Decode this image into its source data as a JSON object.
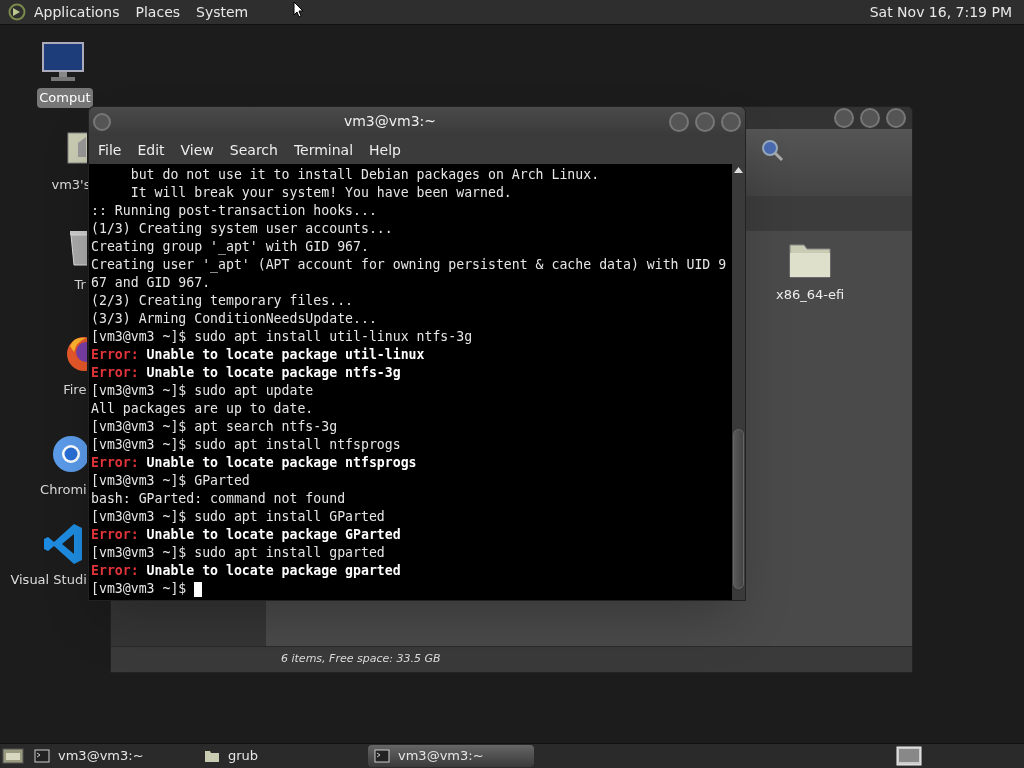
{
  "top_panel": {
    "menus": [
      "Applications",
      "Places",
      "System"
    ],
    "clock": "Sat Nov 16,  7:19 PM"
  },
  "desktop_icons": [
    {
      "kind": "computer",
      "label": "Comput",
      "selected": true
    },
    {
      "kind": "home",
      "label": "vm3's",
      "selected": false
    },
    {
      "kind": "trash",
      "label": "Tr",
      "selected": false
    },
    {
      "kind": "firefox",
      "label": "Fire",
      "selected": false
    },
    {
      "kind": "chromium",
      "label": "Chromi",
      "selected": false
    },
    {
      "kind": "vscode",
      "label": "Visual Studi",
      "selected": false
    }
  ],
  "file_manager": {
    "items": [
      {
        "kind": "folder",
        "label": "x86_64-efi"
      }
    ],
    "status_bar": "6 items, Free space: 33.5 GB"
  },
  "terminal": {
    "title": "vm3@vm3:~",
    "menu": [
      "File",
      "Edit",
      "View",
      "Search",
      "Terminal",
      "Help"
    ],
    "lines": [
      {
        "kind": "plain",
        "text": "     but do not use it to install Debian packages on Arch Linux."
      },
      {
        "kind": "plain",
        "text": "     It will break your system! You have been warned."
      },
      {
        "kind": "plain",
        "text": ":: Running post-transaction hooks..."
      },
      {
        "kind": "plain",
        "text": "(1/3) Creating system user accounts..."
      },
      {
        "kind": "plain",
        "text": "Creating group '_apt' with GID 967."
      },
      {
        "kind": "plain",
        "text": "Creating user '_apt' (APT account for owning persistent & cache data) with UID 9"
      },
      {
        "kind": "plain",
        "text": "67 and GID 967."
      },
      {
        "kind": "plain",
        "text": "(2/3) Creating temporary files..."
      },
      {
        "kind": "plain",
        "text": "(3/3) Arming ConditionNeedsUpdate..."
      },
      {
        "kind": "plain",
        "text": "[vm3@vm3 ~]$ sudo apt install util-linux ntfs-3g"
      },
      {
        "kind": "error",
        "label": "Error:",
        "text": "Unable to locate package util-linux"
      },
      {
        "kind": "error",
        "label": "Error:",
        "text": "Unable to locate package ntfs-3g"
      },
      {
        "kind": "plain",
        "text": "[vm3@vm3 ~]$ sudo apt update"
      },
      {
        "kind": "plain",
        "text": "All packages are up to date."
      },
      {
        "kind": "plain",
        "text": "[vm3@vm3 ~]$ apt search ntfs-3g"
      },
      {
        "kind": "plain",
        "text": "[vm3@vm3 ~]$ sudo apt install ntfsprogs"
      },
      {
        "kind": "error",
        "label": "Error:",
        "text": "Unable to locate package ntfsprogs"
      },
      {
        "kind": "plain",
        "text": "[vm3@vm3 ~]$ GParted"
      },
      {
        "kind": "plain",
        "text": "bash: GParted: command not found"
      },
      {
        "kind": "plain",
        "text": "[vm3@vm3 ~]$ sudo apt install GParted"
      },
      {
        "kind": "error",
        "label": "Error:",
        "text": "Unable to locate package GParted"
      },
      {
        "kind": "plain",
        "text": "[vm3@vm3 ~]$ sudo apt install gparted"
      },
      {
        "kind": "error",
        "label": "Error:",
        "text": "Unable to locate package gparted"
      },
      {
        "kind": "prompt",
        "text": "[vm3@vm3 ~]$ "
      }
    ]
  },
  "taskbar": [
    {
      "kind": "terminal",
      "label": "vm3@vm3:~",
      "selected": false
    },
    {
      "kind": "folder",
      "label": "grub",
      "selected": false
    },
    {
      "kind": "terminal",
      "label": "vm3@vm3:~",
      "selected": true
    }
  ]
}
